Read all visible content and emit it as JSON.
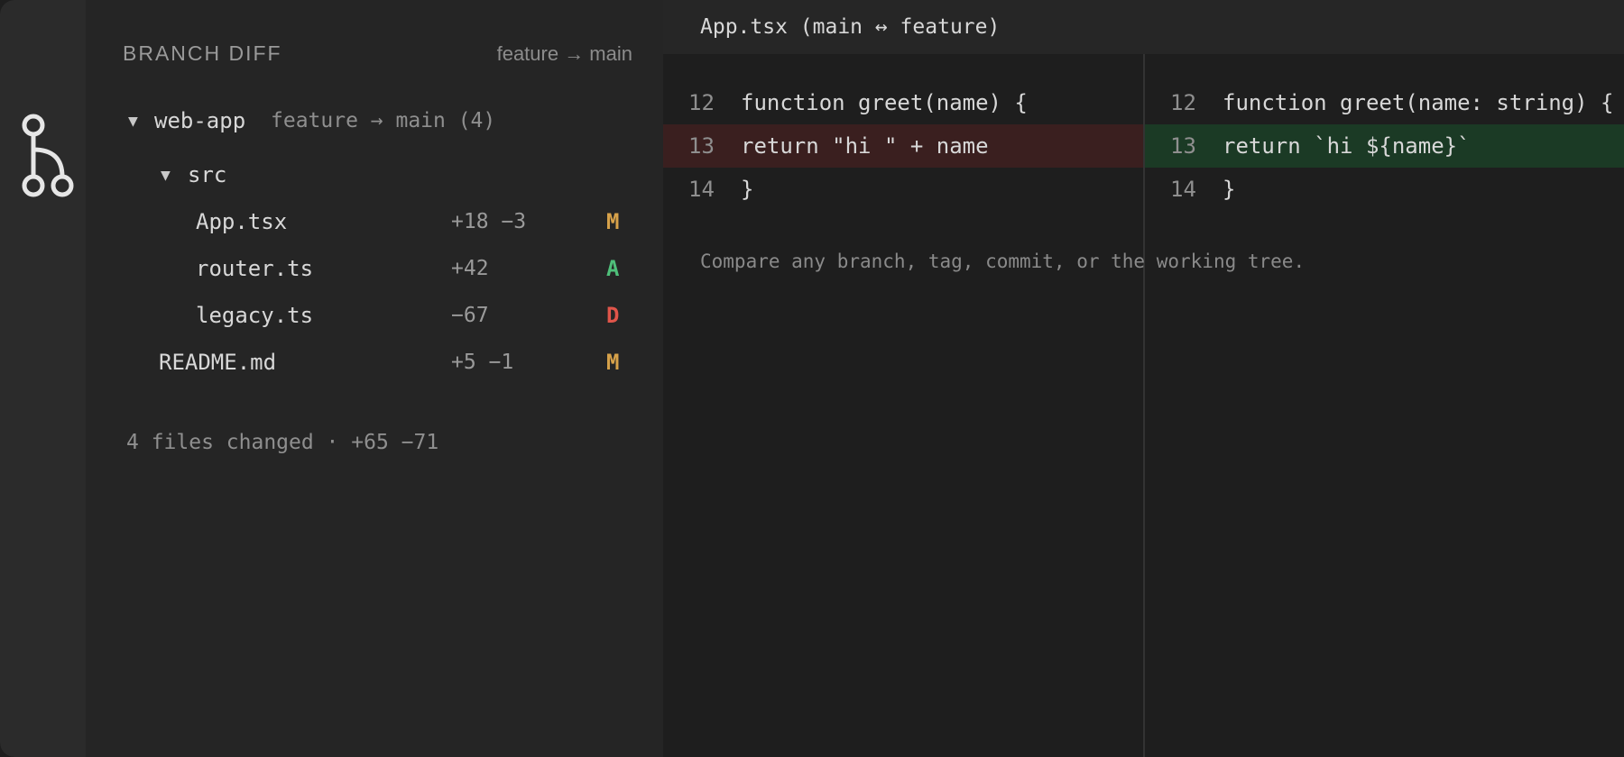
{
  "sidebar": {
    "title": "BRANCH DIFF",
    "compare": "feature → main",
    "repo": {
      "name": "web-app",
      "info": "feature → main (4)"
    },
    "folder": {
      "name": "src"
    },
    "files": [
      {
        "name": "App.tsx",
        "stat": "+18 −3",
        "status": "M"
      },
      {
        "name": "router.ts",
        "stat": "+42",
        "status": "A"
      },
      {
        "name": "legacy.ts",
        "stat": "−67",
        "status": "D"
      },
      {
        "name": "README.md",
        "stat": "+5 −1",
        "status": "M"
      }
    ],
    "summary": "4 files changed · +65 −71"
  },
  "editor": {
    "tab_title": "App.tsx (main ↔ feature)",
    "left": [
      {
        "num": "12",
        "code": "function greet(name) {",
        "kind": "context"
      },
      {
        "num": "13",
        "code": "return \"hi \" + name",
        "kind": "removed"
      },
      {
        "num": "14",
        "code": "}",
        "kind": "context"
      }
    ],
    "right": [
      {
        "num": "12",
        "code": "function greet(name: string) {",
        "kind": "context"
      },
      {
        "num": "13",
        "code": "return `hi ${name}`",
        "kind": "added"
      },
      {
        "num": "14",
        "code": "}",
        "kind": "context"
      }
    ],
    "hint": "Compare any branch, tag, commit, or the working tree."
  },
  "colors": {
    "modified": "#d7a24a",
    "added": "#4fbf7a",
    "deleted": "#e0554a",
    "removed_line_bg": "#3a1f1f",
    "added_line_bg": "#1b3a25"
  },
  "icons": {
    "activity": "git-branch-icon",
    "expand": "chevron-down-icon"
  }
}
